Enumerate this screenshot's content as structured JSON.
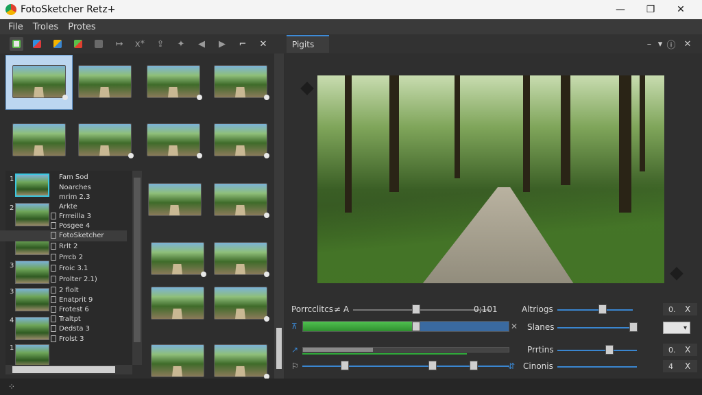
{
  "window": {
    "title": "FotoSketcher  Retz+",
    "minimize": "—",
    "maximize": "❐",
    "close": "✕"
  },
  "menu": [
    "File",
    "Troles",
    "Protes"
  ],
  "toolbar": {
    "arrow_label": "↦",
    "xstar_label": "x*",
    "icons": [
      "copy-icon",
      "flag-icon",
      "paint-icon",
      "color-icon",
      "stop-icon"
    ]
  },
  "tab": {
    "label": "Pigits",
    "menu": "–",
    "pin": "▾",
    "info": "ⓘ",
    "close": "✕"
  },
  "list": {
    "rows": [
      {
        "num": "1",
        "text": "Fam Sod"
      },
      {
        "num": "",
        "text": "Noarches"
      },
      {
        "num": "",
        "text": "mrim 2.3"
      },
      {
        "num": "",
        "text": "Arkte"
      },
      {
        "num": "",
        "text": "Frrreilla 3"
      },
      {
        "num": "",
        "text": "Posgee 4"
      },
      {
        "num": "2",
        "text": "FotoSketcher"
      },
      {
        "num": "",
        "text": "Rrlt 2"
      },
      {
        "num": "",
        "text": "Prrcb 2"
      },
      {
        "num": "",
        "text": "Froic 3.1"
      },
      {
        "num": "",
        "text": "Prolter 2.1)"
      },
      {
        "num": "",
        "text": "2 flolt"
      },
      {
        "num": "",
        "text": "Enatprit 9"
      },
      {
        "num": "",
        "text": "Frotest 6"
      },
      {
        "num": "",
        "text": "Traltpt"
      },
      {
        "num": "",
        "text": "Dedsta 3"
      },
      {
        "num": "",
        "text": "Frolst 3"
      }
    ],
    "side_nums": [
      "2",
      "2",
      "3",
      "3",
      "4",
      "1"
    ]
  },
  "controls": {
    "porrcclitcs": "Porrcclitcs",
    "a_label": "≠ A",
    "value1": "0;101",
    "altriogs": "Altriogs",
    "altriogs_val": "0.",
    "slanes": "Slanes",
    "select_val": "▾",
    "prrtins": "Prrtins",
    "prrtins_val": "0.",
    "cinonis": "Cinonis",
    "cinonis_val": "4",
    "cls": "X"
  },
  "status": {
    "text": "⁘"
  }
}
